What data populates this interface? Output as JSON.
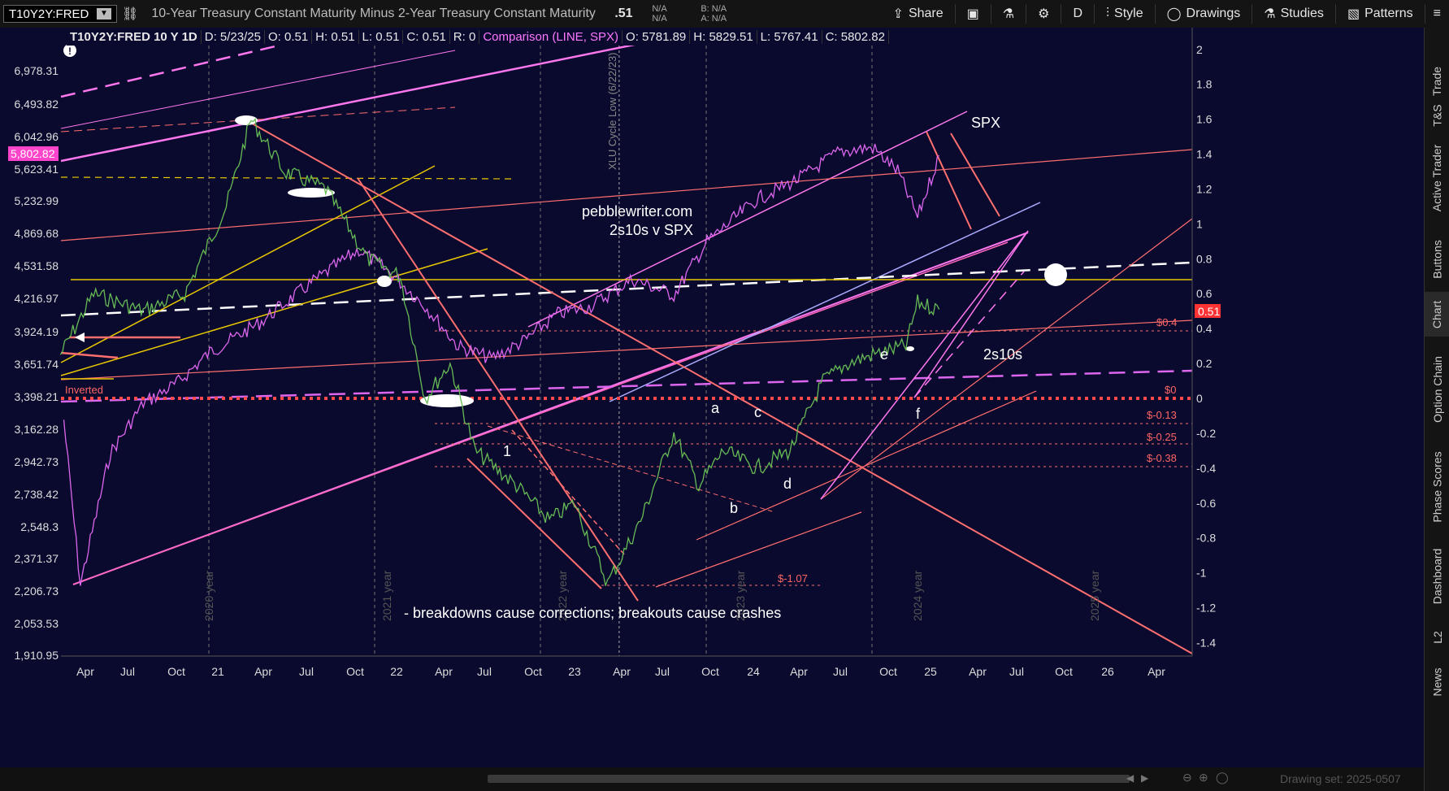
{
  "toolbar": {
    "symbol": "T10Y2Y:FRED",
    "description": "10-Year Treasury Constant Maturity Minus 2-Year Treasury Constant Maturity",
    "last": ".51",
    "nab_line1": "N/A",
    "nab_line2": "N/A",
    "bid": "B: N/A",
    "ask": "A: N/A",
    "share_label": "Share",
    "period": "D",
    "style_label": "Style",
    "drawings_label": "Drawings",
    "studies_label": "Studies",
    "patterns_label": "Patterns"
  },
  "header": {
    "title": "T10Y2Y:FRED 10 Y 1D",
    "date": "D: 5/23/25",
    "open": "O: 0.51",
    "high": "H: 0.51",
    "low": "L: 0.51",
    "close": "C: 0.51",
    "r": "R: 0",
    "comparison": "Comparison (LINE, SPX)",
    "cmp_open": "O: 5781.89",
    "cmp_high": "H: 5829.51",
    "cmp_low": "L: 5767.41",
    "cmp_close": "C: 5802.82"
  },
  "right_tabs": [
    "Trade",
    "T&S",
    "Active Trader",
    "Buttons",
    "Chart",
    "Option Chain",
    "Phase Scores",
    "Dashboard",
    "L2",
    "News"
  ],
  "chart_data": [
    {
      "type": "line",
      "title": "pebblewriter.com",
      "subtitle": "2s10s v SPX",
      "annotation": "- breakdowns cause corrections; breakouts cause crashes",
      "left_axis_ticks": [
        "6,978.31",
        "6,493.82",
        "6,042.96",
        "5,623.41",
        "5,232.99",
        "4,869.68",
        "4,531.58",
        "4,216.97",
        "3,924.19",
        "3,651.74",
        "3,398.21",
        "3,162.28",
        "2,942.73",
        "2,738.42",
        "2,548.3",
        "2,371.37",
        "2,206.73",
        "2,053.53",
        "1,910.95"
      ],
      "right_axis_ticks": [
        "2",
        "1.8",
        "1.6",
        "1.4",
        "1.2",
        "1",
        "0.8",
        "0.6",
        "0.4",
        "0.2",
        "0",
        "-0.2",
        "-0.4",
        "-0.6",
        "-0.8",
        "-1",
        "-1.2",
        "-1.4"
      ],
      "right_ylim": [
        -1.4,
        2.0
      ],
      "x_ticks": [
        "Apr",
        "Jul",
        "Oct",
        "21",
        "Apr",
        "Jul",
        "Oct",
        "22",
        "Apr",
        "Jul",
        "Oct",
        "23",
        "Apr",
        "Jul",
        "Oct",
        "24",
        "Apr",
        "Jul",
        "Oct",
        "25",
        "Apr",
        "Jul",
        "Oct",
        "26",
        "Apr"
      ],
      "year_labels": [
        "2020 year",
        "2021 year",
        "2022 year",
        "2023 year",
        "2024 year",
        "2025 year"
      ],
      "vline_label": "XLU Cycle Low (6/22/23)",
      "spx_price_tag": "5,802.82",
      "spread_value_tag": "0.51",
      "series": [
        {
          "name": "SPX",
          "color": "#dd66ee",
          "x": [
            2020.12,
            2020.22,
            2020.4,
            2020.6,
            2020.8,
            2021.0,
            2021.3,
            2021.6,
            2021.9,
            2022.1,
            2022.3,
            2022.5,
            2022.7,
            2022.9,
            2023.1,
            2023.3,
            2023.55,
            2023.8,
            2024.0,
            2024.3,
            2024.55,
            2024.8,
            2025.0,
            2025.15,
            2025.27,
            2025.4
          ],
          "values": [
            3230,
            2240,
            3000,
            3350,
            3500,
            3750,
            4000,
            4350,
            4700,
            4450,
            4150,
            3800,
            3700,
            3850,
            4080,
            4150,
            4400,
            4250,
            4780,
            5250,
            5500,
            5850,
            5900,
            5600,
            5050,
            5800
          ]
        },
        {
          "name": "2s10s",
          "color": "#66bb55",
          "x": [
            2020.1,
            2020.3,
            2020.6,
            2020.85,
            2021.1,
            2021.25,
            2021.45,
            2021.7,
            2021.95,
            2022.15,
            2022.3,
            2022.45,
            2022.6,
            2022.85,
            2023.05,
            2023.2,
            2023.4,
            2023.6,
            2023.8,
            2023.95,
            2024.1,
            2024.3,
            2024.5,
            2024.7,
            2024.85,
            2025.0,
            2025.2,
            2025.27,
            2025.4
          ],
          "values": [
            0.25,
            0.6,
            0.5,
            0.6,
            1.1,
            1.6,
            1.3,
            1.2,
            0.8,
            0.7,
            0.0,
            0.2,
            -0.3,
            -0.5,
            -0.7,
            -0.6,
            -1.06,
            -0.7,
            -0.2,
            -0.5,
            -0.3,
            -0.4,
            -0.3,
            0.1,
            0.2,
            0.25,
            0.3,
            0.55,
            0.51
          ]
        }
      ],
      "labels": {
        "spx_tag": "SPX",
        "spread_tag": "2s10s",
        "inverted": "Inverted",
        "wave_labels": [
          "1",
          "a",
          "b",
          "c",
          "d",
          "e",
          "f"
        ],
        "level_labels": [
          "$0.4",
          "$0",
          "$-0.13",
          "$-0.25",
          "$-0.38",
          "$-1.07"
        ]
      }
    }
  ],
  "footer": {
    "drawing_set": "Drawing set: 2025-0507"
  }
}
